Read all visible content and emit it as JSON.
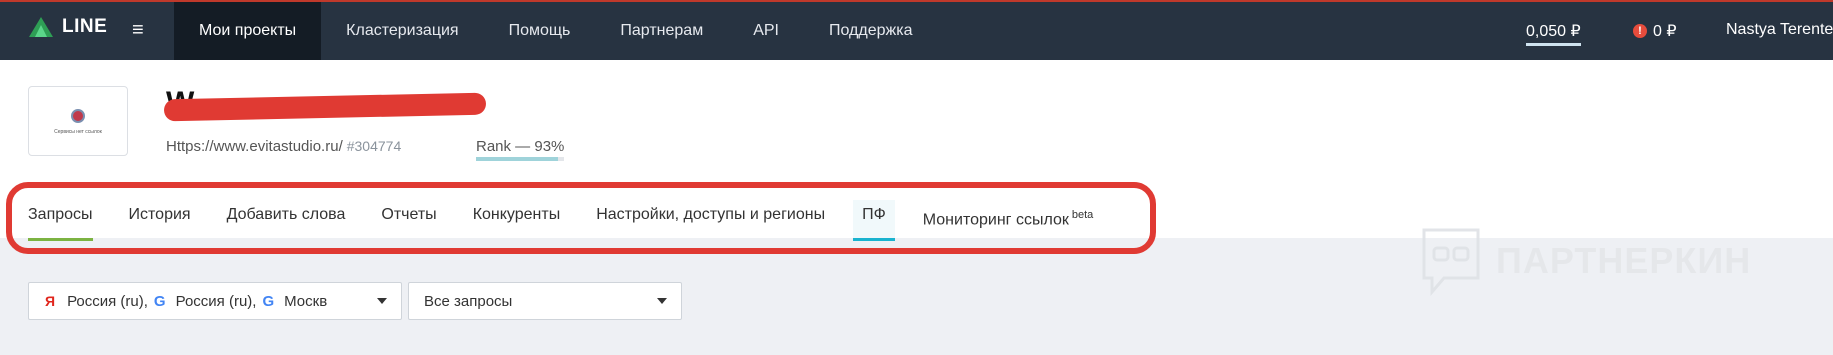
{
  "nav": {
    "logo_text": "LINE",
    "items": [
      {
        "label": "Мои проекты",
        "active": true
      },
      {
        "label": "Кластеризация"
      },
      {
        "label": "Помощь"
      },
      {
        "label": "Партнерам"
      },
      {
        "label": "API"
      },
      {
        "label": "Поддержка"
      }
    ],
    "balance": "0,050 ₽",
    "alert_balance": "0 ₽",
    "user_name": "Nastya Terente"
  },
  "project": {
    "title": "W              ",
    "url": "Https://www.evitastudio.ru/",
    "id": "#304774",
    "rank_label": "Rank — 93%",
    "rank_value": 0.93,
    "thumb_caption": "Сервиcы нет ссылок"
  },
  "tabs": [
    {
      "label": "Запросы",
      "active": true
    },
    {
      "label": "История"
    },
    {
      "label": "Добавить слова"
    },
    {
      "label": "Отчеты"
    },
    {
      "label": "Конкуренты"
    },
    {
      "label": "Настройки, доступы и регионы"
    },
    {
      "label": "ПФ",
      "selected": true
    },
    {
      "label": "Мониторинг ссылок",
      "sup": "beta"
    }
  ],
  "watermark": "ПАРТНЕРКИН",
  "filters": {
    "regions": {
      "yandex_icon": "Я",
      "r1": "Россия (ru),",
      "google_icon": "G",
      "r2": "Россия (ru),",
      "r3": "Москв"
    },
    "queries": "Все запросы"
  },
  "colors": {
    "navbar": "#273341",
    "active_tab": "#7cb342",
    "pf_tab": "#1ab3cf",
    "annotation": "#e03a33"
  }
}
